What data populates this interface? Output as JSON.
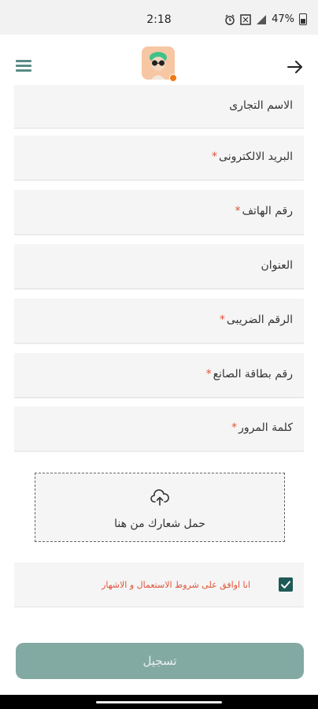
{
  "status_bar": {
    "time": "2:18",
    "battery_percent": "47%",
    "icons": [
      "alarm-icon",
      "nfc-icon",
      "signal-icon",
      "battery-icon"
    ]
  },
  "app_bar": {
    "menu_icon": "menu-icon",
    "avatar_icon": "avatar",
    "back_icon": "arrow-right-icon"
  },
  "form": {
    "fields": [
      {
        "label": "الاسم التجارى",
        "required": false
      },
      {
        "label": "البريد الالكترونى",
        "required": true
      },
      {
        "label": "رقم الهاتف",
        "required": true
      },
      {
        "label": "العنوان",
        "required": false
      },
      {
        "label": "الرقم الضريبى",
        "required": true
      },
      {
        "label": "رقم بطاقة الصانع",
        "required": true
      },
      {
        "label": "كلمة المرور",
        "required": true
      }
    ],
    "required_mark": "*",
    "upload": {
      "label": "حمل شعارك من هنا",
      "icon": "upload-cloud-icon"
    },
    "terms": {
      "label": "انا اوافق على شروط الاستعمال و الاشهار",
      "checked": true
    },
    "submit_label": "تسجيل"
  },
  "colors": {
    "accent": "#5b8b86",
    "button": "#83a9a3",
    "checkbox": "#1f5a56",
    "required": "#e0533a",
    "badge": "#f07a12"
  }
}
